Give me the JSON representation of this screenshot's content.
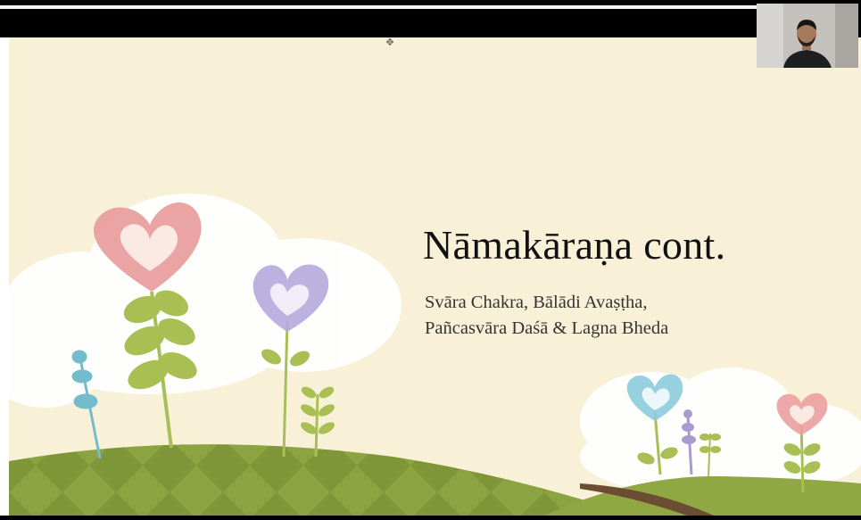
{
  "slide": {
    "title": "Nāmakāraṇa cont.",
    "subtitle_lines": [
      "Svāra Chakra, Bālādi Avaṣṭha,",
      "Pañcasvāra Daśā & Lagna Bheda"
    ]
  },
  "icons": {
    "top_marker": "✥",
    "presenter": "webcam-participant"
  },
  "colors": {
    "slide_background": "#f8f1d8",
    "hill_dark": "#6f8431",
    "hill_light": "#9bb04f",
    "heart_pink": "#e98e8e",
    "heart_purple": "#b3a4d8",
    "heart_blue": "#8cc8d8",
    "leaf_green": "#9fb54c"
  }
}
